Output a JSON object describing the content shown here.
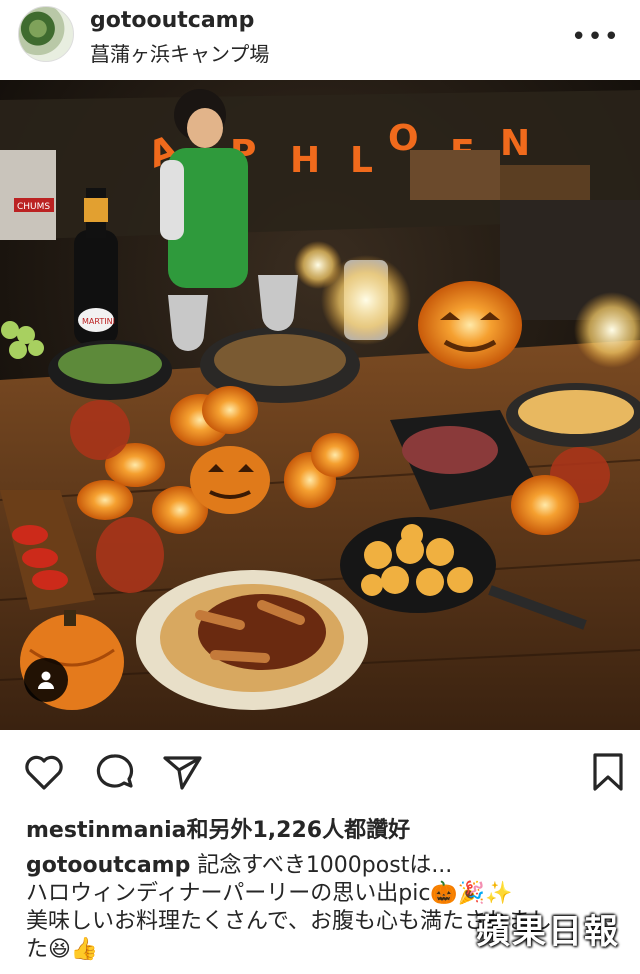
{
  "post": {
    "username": "gotooutcamp",
    "location": "菖蒲ヶ浜キャンプ場",
    "more_icon": "more-horizontal-icon",
    "photo_banner_letters": [
      "A",
      "P",
      "H",
      "L",
      "O",
      "E",
      "N"
    ],
    "photo_label_chums": "CHUMS",
    "photo_label_martini": "MARTINI"
  },
  "actions": {
    "like_icon": "heart-outline-icon",
    "comment_icon": "comment-bubble-icon",
    "share_icon": "paper-plane-icon",
    "save_icon": "bookmark-icon"
  },
  "likes": {
    "text": "mestinmania和另外1,226人都讚好"
  },
  "caption": {
    "username": "gotooutcamp",
    "line1": " 記念すべき1000postは...",
    "line2": "ハロウィンディナーパーリーの思い出pic🎃🎉✨",
    "line3": "美味しいお料理たくさんで、お腹も心も満たされまし",
    "line4": "た😆👍"
  },
  "watermark": "蘋果日報"
}
